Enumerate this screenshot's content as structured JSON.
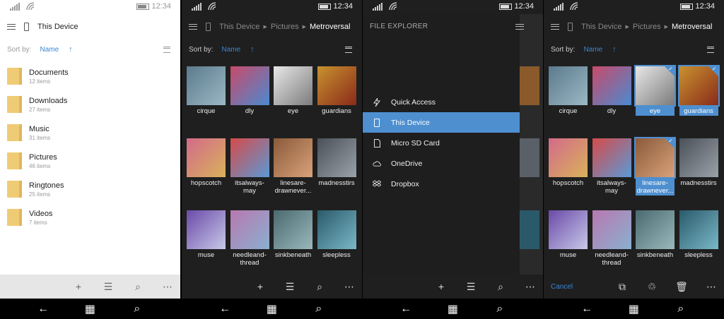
{
  "status": {
    "time": "12:34"
  },
  "screen1": {
    "location": "This Device",
    "sort": {
      "label": "Sort by:",
      "value": "Name"
    },
    "folders": [
      {
        "name": "Documents",
        "count": "12 items"
      },
      {
        "name": "Downloads",
        "count": "27 items"
      },
      {
        "name": "Music",
        "count": "31 items"
      },
      {
        "name": "Pictures",
        "count": "46 items"
      },
      {
        "name": "Ringtones",
        "count": "25 items"
      },
      {
        "name": "Videos",
        "count": "7 items"
      }
    ]
  },
  "breadcrumb": {
    "root": "This Device",
    "mid": "Pictures",
    "current": "Metroversal"
  },
  "sort": {
    "label": "Sort by:",
    "value": "Name"
  },
  "pictures": [
    {
      "name": "cirque",
      "colors": [
        "#5b7a8c",
        "#9bb8c5"
      ]
    },
    {
      "name": "dly",
      "colors": [
        "#c94a6a",
        "#4a8ad0"
      ]
    },
    {
      "name": "eye",
      "colors": [
        "#e8e8e8",
        "#7b7b7b"
      ]
    },
    {
      "name": "guardians",
      "colors": [
        "#c8922e",
        "#8a2a1a"
      ]
    },
    {
      "name": "hopscotch",
      "colors": [
        "#d36a8a",
        "#d9b25a"
      ]
    },
    {
      "name": "itsalways-may",
      "colors": [
        "#d64a4a",
        "#5a9ad6"
      ]
    },
    {
      "name": "linesare-drawnever...",
      "colors": [
        "#8a5a3a",
        "#d9a27a"
      ]
    },
    {
      "name": "madnesstirs",
      "colors": [
        "#4a5058",
        "#9aa2aa"
      ]
    },
    {
      "name": "muse",
      "colors": [
        "#6a4aa8",
        "#c8c8e8"
      ]
    },
    {
      "name": "needleand-thread",
      "colors": [
        "#b878b0",
        "#8ab0d0"
      ]
    },
    {
      "name": "sinkbeneath",
      "colors": [
        "#4a6a70",
        "#9ab8bc"
      ]
    },
    {
      "name": "sleepless",
      "colors": [
        "#2a5a6a",
        "#7ab8c8"
      ]
    }
  ],
  "drawer": {
    "title": "FILE EXPLORER",
    "items": [
      "Quick Access",
      "This Device",
      "Micro SD Card",
      "OneDrive",
      "Dropbox"
    ]
  },
  "selection": {
    "cancel": "Cancel",
    "selected": [
      "eye",
      "guardians",
      "linesare-drawnever..."
    ]
  }
}
